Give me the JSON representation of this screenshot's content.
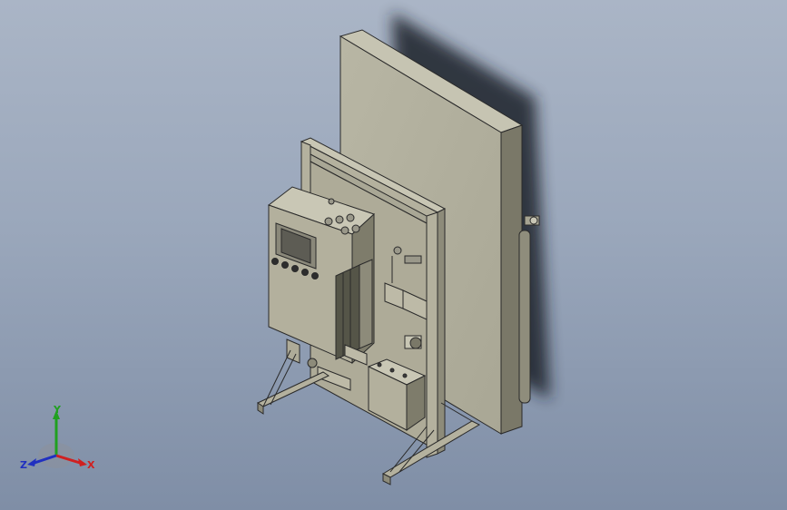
{
  "view": {
    "background_top": "#aab5c6",
    "background_bottom": "#7f8ea6",
    "model_color": "#b4b19e",
    "edge_color": "#2b2b2b"
  },
  "triad": {
    "x_label": "X",
    "y_label": "Y",
    "z_label": "Z",
    "x_color": "#d02020",
    "y_color": "#20a020",
    "z_color": "#2030c0"
  }
}
